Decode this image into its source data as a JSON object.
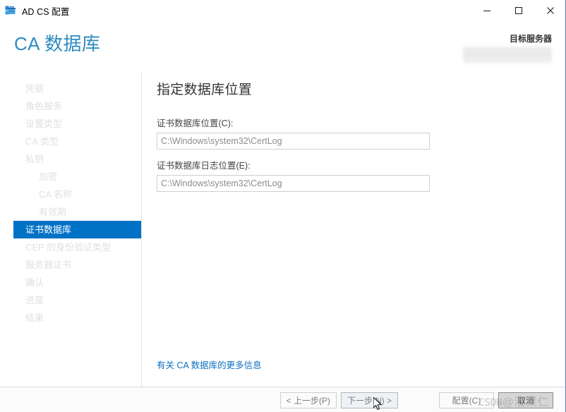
{
  "window": {
    "title": "AD CS 配置",
    "app_icon": "server-config-icon",
    "controls": {
      "minimize": "minimize-icon",
      "maximize": "maximize-icon",
      "close": "close-icon"
    }
  },
  "header": {
    "page_title": "CA 数据库",
    "destination_server_label": "目标服务器",
    "destination_server_name": ""
  },
  "sidebar": {
    "items": [
      {
        "label": "凭据",
        "state": "visited",
        "sub": false
      },
      {
        "label": "角色服务",
        "state": "visited",
        "sub": false
      },
      {
        "label": "设置类型",
        "state": "visited",
        "sub": false
      },
      {
        "label": "CA 类型",
        "state": "visited",
        "sub": false
      },
      {
        "label": "私钥",
        "state": "visited",
        "sub": false
      },
      {
        "label": "加密",
        "state": "visited",
        "sub": true
      },
      {
        "label": "CA 名称",
        "state": "visited",
        "sub": true
      },
      {
        "label": "有效期",
        "state": "visited",
        "sub": true
      },
      {
        "label": "证书数据库",
        "state": "active",
        "sub": false
      },
      {
        "label": "CEP 的身份验证类型",
        "state": "pending",
        "sub": false
      },
      {
        "label": "服务器证书",
        "state": "pending",
        "sub": false
      },
      {
        "label": "确认",
        "state": "pending",
        "sub": false
      },
      {
        "label": "进度",
        "state": "pending",
        "sub": false
      },
      {
        "label": "结果",
        "state": "pending",
        "sub": false
      }
    ]
  },
  "main": {
    "section_heading": "指定数据库位置",
    "fields": [
      {
        "label": "证书数据库位置(C):",
        "value": "C:\\Windows\\system32\\CertLog"
      },
      {
        "label": "证书数据库日志位置(E):",
        "value": "C:\\Windows\\system32\\CertLog"
      }
    ],
    "more_info_link": "有关 CA 数据库的更多信息"
  },
  "footer": {
    "buttons": [
      {
        "label": "< 上一步(P)",
        "name": "previous-button",
        "state": "enabled"
      },
      {
        "label": "下一步(N) >",
        "name": "next-button",
        "state": "hovered"
      },
      {
        "label": "配置(C)",
        "name": "configure-button",
        "state": "enabled"
      },
      {
        "label": "取消",
        "name": "cancel-button",
        "state": "enabled"
      }
    ]
  },
  "watermark": {
    "brand": "CSDN",
    "handle": "@灌果仁"
  },
  "colors": {
    "accent_blue": "#0072c6",
    "title_blue": "#2e8bc0",
    "link_blue": "#0c6fc0",
    "window_bg": "#ffffff",
    "footer_bg": "#fbfbfb",
    "disabled_text": "#dfe0e1"
  }
}
